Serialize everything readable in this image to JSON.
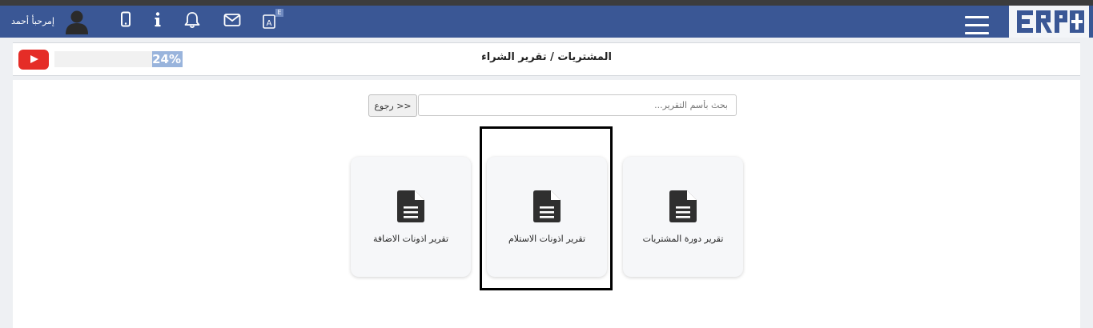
{
  "header": {
    "greeting": "إمرحبأ أحمد",
    "notification_badge": "E",
    "colors": {
      "navbar": "#3a5795",
      "topstrip": "#3c3c3c"
    },
    "icons": [
      "user-avatar-icon",
      "mobile-icon",
      "info-icon",
      "bell-icon",
      "mail-icon",
      "language-icon",
      "menu-icon",
      "erp-logo"
    ]
  },
  "titlebar": {
    "title": "المشتريات / تقرير الشراء",
    "progress_value": 24,
    "progress_label": "24%"
  },
  "search": {
    "placeholder": "بحث بأسم التقرير...",
    "value": "",
    "back_label": "<< رجوع"
  },
  "cards": [
    {
      "label": "تقرير دورة المشتريات",
      "icon": "document-icon"
    },
    {
      "label": "تقرير اذونات الاستلام",
      "icon": "document-icon",
      "highlighted": true
    },
    {
      "label": "تقرير اذونات الاضافة",
      "icon": "document-icon"
    }
  ]
}
